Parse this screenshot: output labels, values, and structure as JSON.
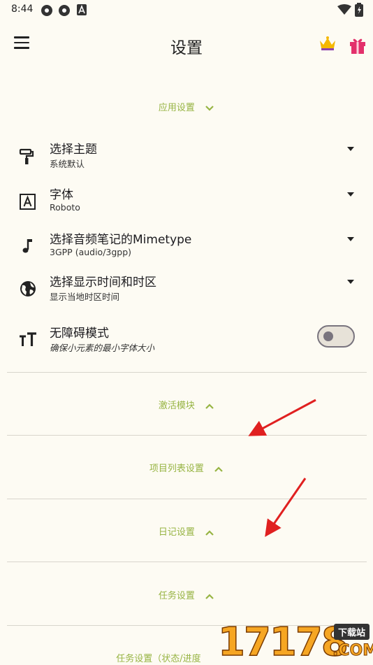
{
  "status_bar": {
    "time": "8:44"
  },
  "app_bar": {
    "title": "设置"
  },
  "sections": {
    "app_settings": "应用设置",
    "activate_modules": "激活模块",
    "project_list_settings": "项目列表设置",
    "diary_settings": "日记设置",
    "task_settings": "任务设置",
    "task_settings_status": "任务设置（状态/进度"
  },
  "settings": [
    {
      "title": "选择主题",
      "subtitle": "系统默认",
      "icon": "paint-roller-icon"
    },
    {
      "title": "字体",
      "subtitle": "Roboto",
      "icon": "font-icon"
    },
    {
      "title": "选择音频笔记的Mimetype",
      "subtitle": "3GPP (audio/3gpp)",
      "icon": "music-note-icon"
    },
    {
      "title": "选择显示时间和时区",
      "subtitle": "显示当地时区时间",
      "icon": "globe-icon"
    },
    {
      "title": "无障碍模式",
      "subtitle": "确保小元素的最小字体大小",
      "icon": "text-size-icon",
      "toggle": "off"
    }
  ],
  "watermark": {
    "number": "17178",
    "badge": "下载站",
    "suffix": ".COM"
  },
  "colors": {
    "background": "#FDFBF3",
    "accent": "#97B443",
    "arrow": "#E02020"
  }
}
